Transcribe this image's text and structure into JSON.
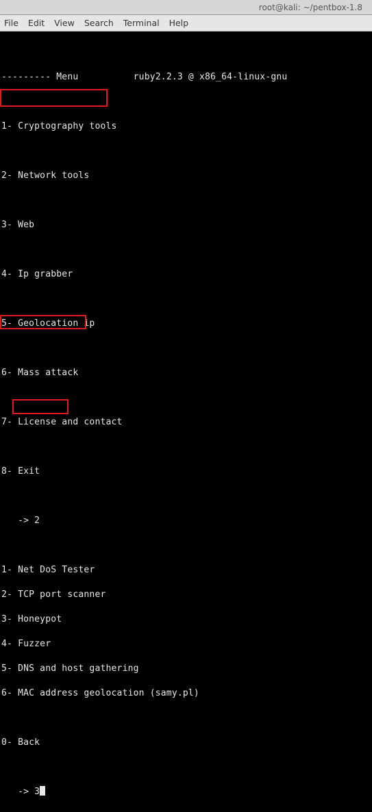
{
  "window": {
    "title": "root@kali: ~/pentbox-1.8"
  },
  "menubar": {
    "file": "File",
    "edit": "Edit",
    "view": "View",
    "search": "Search",
    "terminal": "Terminal",
    "help": "Help"
  },
  "terminal": {
    "header_left": "--------- Menu",
    "header_right": "ruby2.2.3 @ x86_64-linux-gnu",
    "main_menu": [
      "1- Cryptography tools",
      "2- Network tools",
      "3- Web",
      "4- Ip grabber",
      "5- Geolocation ip",
      "6- Mass attack",
      "7- License and contact",
      "8- Exit"
    ],
    "prompt1": "   -> 2",
    "sub_menu": [
      "1- Net DoS Tester",
      "2- TCP port scanner",
      "3- Honeypot",
      "4- Fuzzer",
      "5- DNS and host gathering",
      "6- MAC address geolocation (samy.pl)"
    ],
    "back": "0- Back",
    "prompt2_prefix": "   -> 3"
  }
}
